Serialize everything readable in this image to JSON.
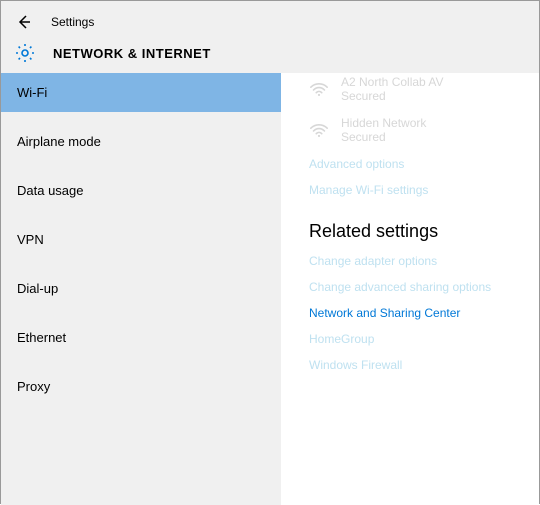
{
  "header": {
    "appTitle": "Settings",
    "pageTitle": "NETWORK & INTERNET"
  },
  "sidebar": {
    "items": [
      {
        "label": "Wi-Fi",
        "selected": true
      },
      {
        "label": "Airplane mode",
        "selected": false
      },
      {
        "label": "Data usage",
        "selected": false
      },
      {
        "label": "VPN",
        "selected": false
      },
      {
        "label": "Dial-up",
        "selected": false
      },
      {
        "label": "Ethernet",
        "selected": false
      },
      {
        "label": "Proxy",
        "selected": false
      }
    ]
  },
  "content": {
    "networks": [
      {
        "name": "A2 North Collab AV",
        "status": "Secured"
      },
      {
        "name": "Hidden Network",
        "status": "Secured"
      }
    ],
    "advancedOptions": "Advanced options",
    "manageWifi": "Manage Wi-Fi settings",
    "relatedHeader": "Related settings",
    "links": [
      "Change adapter options",
      "Change advanced sharing options",
      "Network and Sharing Center",
      "HomeGroup",
      "Windows Firewall"
    ]
  },
  "colors": {
    "accent": "#0078d7",
    "selectedBg": "#7fb5e5",
    "fadedLink": "#bfe1f0",
    "sidebarBg": "#f0f0f0"
  }
}
